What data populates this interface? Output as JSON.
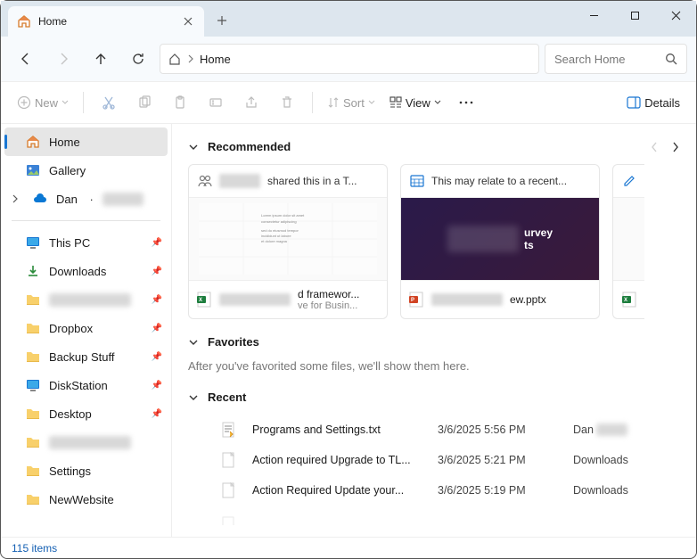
{
  "window": {
    "tab_title": "Home",
    "new_tab_tooltip": "New tab"
  },
  "address": {
    "current": "Home"
  },
  "search": {
    "placeholder": "Search Home"
  },
  "toolbar": {
    "new_label": "New",
    "sort_label": "Sort",
    "view_label": "View",
    "details_label": "Details"
  },
  "sidebar": {
    "home": "Home",
    "gallery": "Gallery",
    "user": "Dan",
    "pinned": [
      {
        "label": "This PC",
        "icon": "pc"
      },
      {
        "label": "Downloads",
        "icon": "download"
      },
      {
        "label": "",
        "icon": "folder",
        "blurred": true
      },
      {
        "label": "Dropbox",
        "icon": "folder"
      },
      {
        "label": "Backup Stuff",
        "icon": "folder"
      },
      {
        "label": "DiskStation",
        "icon": "pc"
      },
      {
        "label": "Desktop",
        "icon": "folder"
      },
      {
        "label": "",
        "icon": "folder",
        "blurred": true
      },
      {
        "label": "Settings",
        "icon": "folder"
      },
      {
        "label": "NewWebsite",
        "icon": "folder"
      }
    ]
  },
  "sections": {
    "recommended": "Recommended",
    "favorites": "Favorites",
    "favorites_empty": "After you've favorited some files, we'll show them here.",
    "recent": "Recent"
  },
  "recommended": [
    {
      "head": "shared this in a T...",
      "foot_line1": "d framewor...",
      "foot_line2": "ve for Busin...",
      "file_icon": "xlsx"
    },
    {
      "head": "This may relate to a recent...",
      "foot_line1": "ew.pptx",
      "foot_line2": "",
      "file_icon": "pptx",
      "dark": true,
      "preview_text": "urvey\nts"
    }
  ],
  "recent": [
    {
      "name": "Programs and Settings.txt",
      "date": "3/6/2025 5:56 PM",
      "location": "Dan",
      "icon": "txt"
    },
    {
      "name": "Action required Upgrade to TL...",
      "date": "3/6/2025 5:21 PM",
      "location": "Downloads",
      "icon": "doc"
    },
    {
      "name": "Action Required Update your...",
      "date": "3/6/2025 5:19 PM",
      "location": "Downloads",
      "icon": "doc"
    }
  ],
  "statusbar": {
    "count": "115 items"
  }
}
